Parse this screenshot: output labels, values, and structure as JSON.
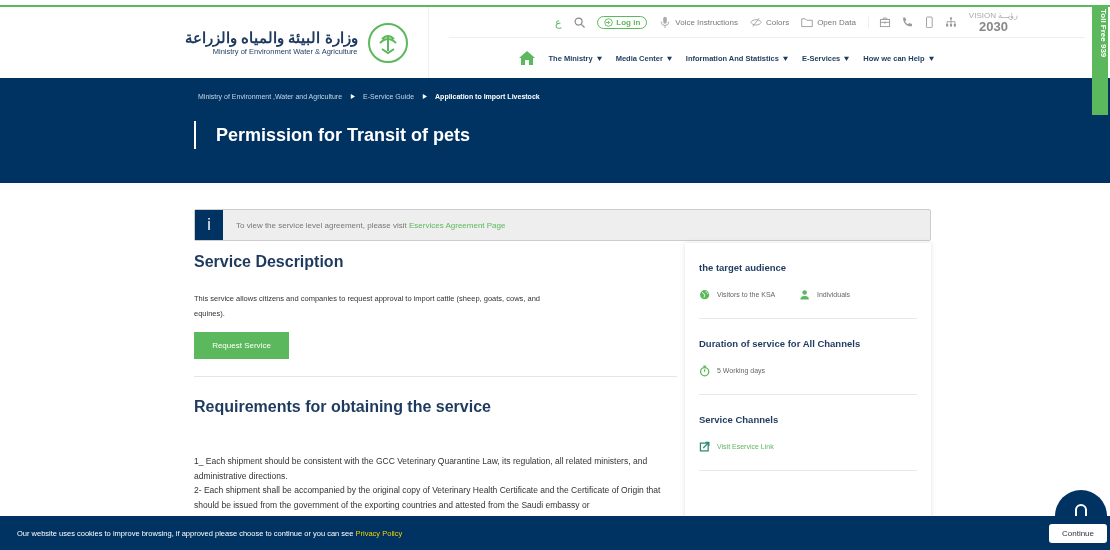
{
  "header": {
    "logo": {
      "arabic": "وزارة البيئة والمياه والزراعة",
      "english": "Ministry of Environment Water & Agriculture"
    },
    "utility": {
      "language": "ع",
      "login": "Log in",
      "links": [
        {
          "kind": "mic",
          "label": "Voice Instructions"
        },
        {
          "kind": "eye",
          "label": "Colors"
        },
        {
          "kind": "folder",
          "label": "Open Data"
        }
      ],
      "vision": {
        "top": "VISION رؤيـــة",
        "number": "2030"
      }
    },
    "nav": [
      {
        "label": "The Ministry"
      },
      {
        "label": "Media Center"
      },
      {
        "label": "Information And Statistics"
      },
      {
        "label": "E-Services"
      },
      {
        "label": "How we can Help"
      }
    ],
    "toll_free": "Toll Free 939"
  },
  "hero": {
    "breadcrumbs": [
      {
        "label": "Ministry of Environment ,Water and Agriculture",
        "current": false
      },
      {
        "label": "E-Service Guide",
        "current": false
      },
      {
        "label": "Application to Import Livestock",
        "current": true
      }
    ],
    "title": "Permission for Transit of pets"
  },
  "notice": {
    "icon_text": "i",
    "text": "To view the service level agreement, please visit ",
    "link": "Eservices Agreement Page"
  },
  "description": {
    "heading": "Service Description",
    "text": "This service allows citizens and companies to request approval to import cattle (sheep, goats, cows, and equines).",
    "button": "Request Service"
  },
  "requirements": {
    "heading": "Requirements for obtaining the service",
    "items": [
      "1_ Each shipment should be consistent with the GCC Veterinary Quarantine Law, its regulation, all related ministers, and administrative directions.",
      "2- Each shipment shall be accompanied by the original copy of Veterinary Health Certificate and the Certificate of Origin that should be issued from the government of the exporting countries and attested from the Saudi embassy or"
    ]
  },
  "sidebar": {
    "sections": [
      {
        "kind": "audience",
        "title": "the target audience",
        "items": [
          {
            "label": "Visitors to the KSA"
          },
          {
            "label": "Individuals"
          }
        ]
      },
      {
        "kind": "duration",
        "title": "Duration of service for All Channels",
        "items": [
          {
            "label": "5 Working days"
          }
        ]
      },
      {
        "kind": "channels",
        "title": "Service Channels",
        "items": [
          {
            "label": "Visit Eservice Link"
          }
        ]
      }
    ]
  },
  "cookie_bar": {
    "text": "Our website uses cookies to improve browsing, if approved please choose to continue or you can see ",
    "link": "Privacy Policy",
    "button": "Continue"
  }
}
